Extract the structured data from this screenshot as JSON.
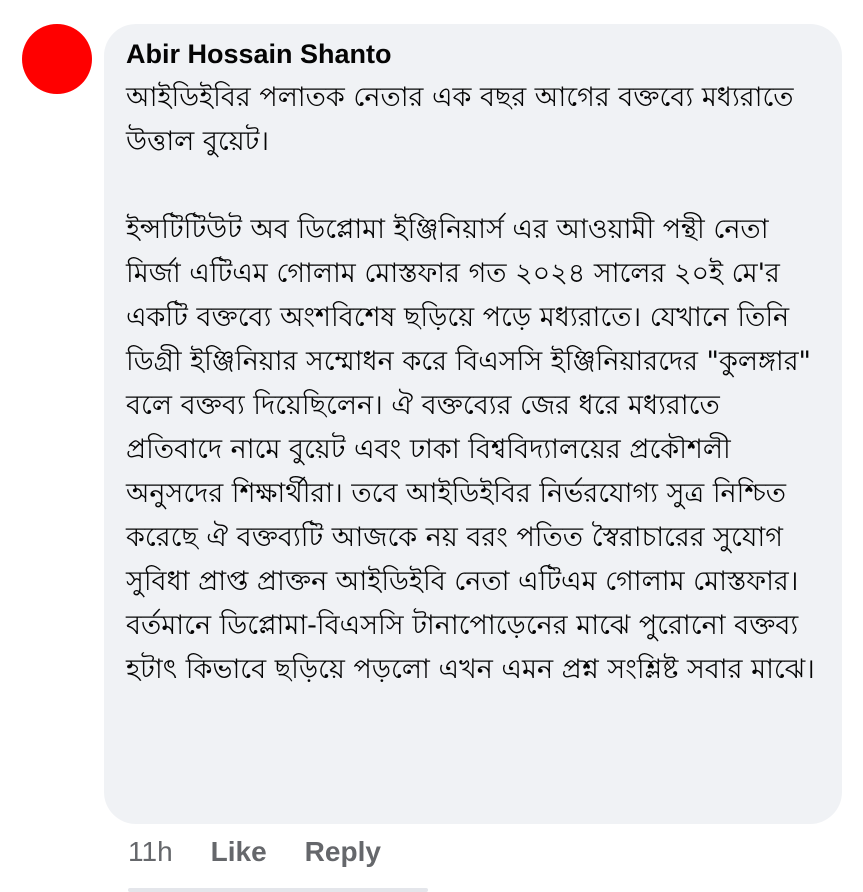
{
  "comment": {
    "author": "Abir Hossain Shanto",
    "avatar_color": "#ff0000",
    "paragraph_1": "আইডিইবির পলাতক নেতার এক বছর আগের বক্তব্যে মধ্যরাতে উত্তাল বুয়েট।",
    "paragraph_2": "ইন্সটিটিউট অব ডিপ্লোমা ইঞ্জিনিয়ার্স এর আওয়ামী পন্থী নেতা মির্জা এটিএম গোলাম মোস্তফার গত ২০২৪ সালের ২০ই মে'র একটি বক্তব্যে অংশবিশেষ ছড়িয়ে পড়ে মধ্যরাতে। যেখানে তিনি ডিগ্রী ইঞ্জিনিয়ার সম্মোধন করে বিএসসি ইঞ্জিনিয়ারদের \"কুলঙ্গার\" বলে বক্তব্য দিয়েছিলেন। ঐ বক্তব্যের জের ধরে মধ্যরাতে প্রতিবাদে নামে বুয়েট এবং ঢাকা বিশ্ববিদ্যালয়ের প্রকৌশলী অনুসদের শিক্ষার্থীরা। তবে আইডিইবির নির্ভরযোগ্য সুত্র নিশ্চিত করেছে ঐ বক্তব্যটি আজকে নয় বরং পতিত স্বৈরাচারের সুযোগ সুবিধা প্রাপ্ত প্রাক্তন আইডিইবি নেতা এটিএম গোলাম মোস্তফার। বর্তমানে ডিপ্লোমা-বিএসসি টানাপোড়েনের মাঝে পুরোনো বক্তব্য হটাৎ কিভাবে ছড়িয়ে পড়লো এখন এমন প্রশ্ন সংশ্লিষ্ট সবার মাঝে।",
    "timestamp": "11h",
    "like_label": "Like",
    "reply_label": "Reply"
  }
}
